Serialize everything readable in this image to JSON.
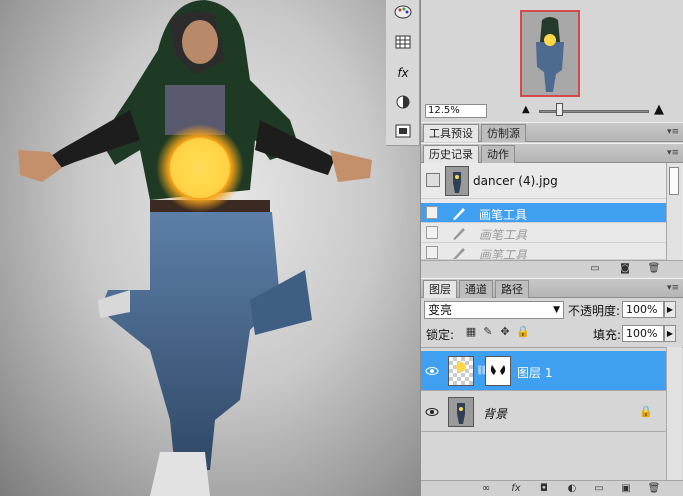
{
  "colors": {
    "selection": "#3f9ff1",
    "navigator_frame": "#d24a4a",
    "panel_bg": "#d4d4d4",
    "orb_core": "#ffd84a"
  },
  "tool_strip": {
    "icons": [
      "brush-palette-icon",
      "grid-icon",
      "fx-icon",
      "contrast-icon",
      "layer-comp-icon"
    ],
    "fx_label": "fx"
  },
  "navigator": {
    "zoom": "12.5%",
    "zoom_level": 0.15
  },
  "tool_presets_panel": {
    "tabs": [
      "工具预设",
      "仿制源"
    ]
  },
  "history_panel": {
    "tabs": [
      "历史记录",
      "动作"
    ],
    "snapshot": "dancer (4).jpg",
    "items": [
      "画笔工具",
      "画笔工具",
      "画笔工具"
    ]
  },
  "layers_panel": {
    "tabs": [
      "图层",
      "通道",
      "路径"
    ],
    "blend_mode": "变亮",
    "opacity_label": "不透明度:",
    "opacity": "100%",
    "lock_label": "锁定:",
    "fill_label": "填充:",
    "fill": "100%",
    "layers": [
      {
        "name": "图层 1"
      },
      {
        "name": "背景"
      }
    ],
    "footer_icons": [
      "link-icon",
      "fx-icon",
      "mask-icon",
      "adjustment-icon",
      "group-icon",
      "new-layer-icon",
      "trash-icon"
    ]
  }
}
